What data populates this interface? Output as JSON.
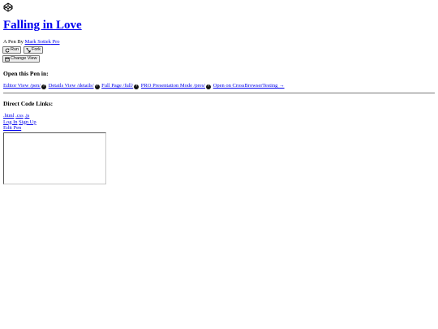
{
  "logo": {
    "icon": "codepen-icon"
  },
  "pen": {
    "title": "Falling in Love",
    "byline_prefix": "A Pen By",
    "author": "Mark Sottek",
    "author_badge": "Pro"
  },
  "buttons": {
    "run": "Run",
    "fork": "Fork",
    "change_view": "Change View"
  },
  "open_section": {
    "heading": "Open this Pen in:",
    "links": [
      {
        "label": "Editor View",
        "path": "/pen/"
      },
      {
        "label": "Details View",
        "path": "/details/"
      },
      {
        "label": "Full Page",
        "path": "/full/"
      },
      {
        "label": "PRO Presentation Mode",
        "path": "/pres/"
      },
      {
        "label": "Open on CrossBrowserTesting",
        "arrow": "→"
      }
    ],
    "help_icon": "question-circle-icon"
  },
  "code_section": {
    "heading": "Direct Code Links:",
    "links": [
      ".html",
      ".css",
      ".js"
    ],
    "login": "Log In",
    "signup": "Sign Up",
    "edit": "Edit Pen"
  }
}
